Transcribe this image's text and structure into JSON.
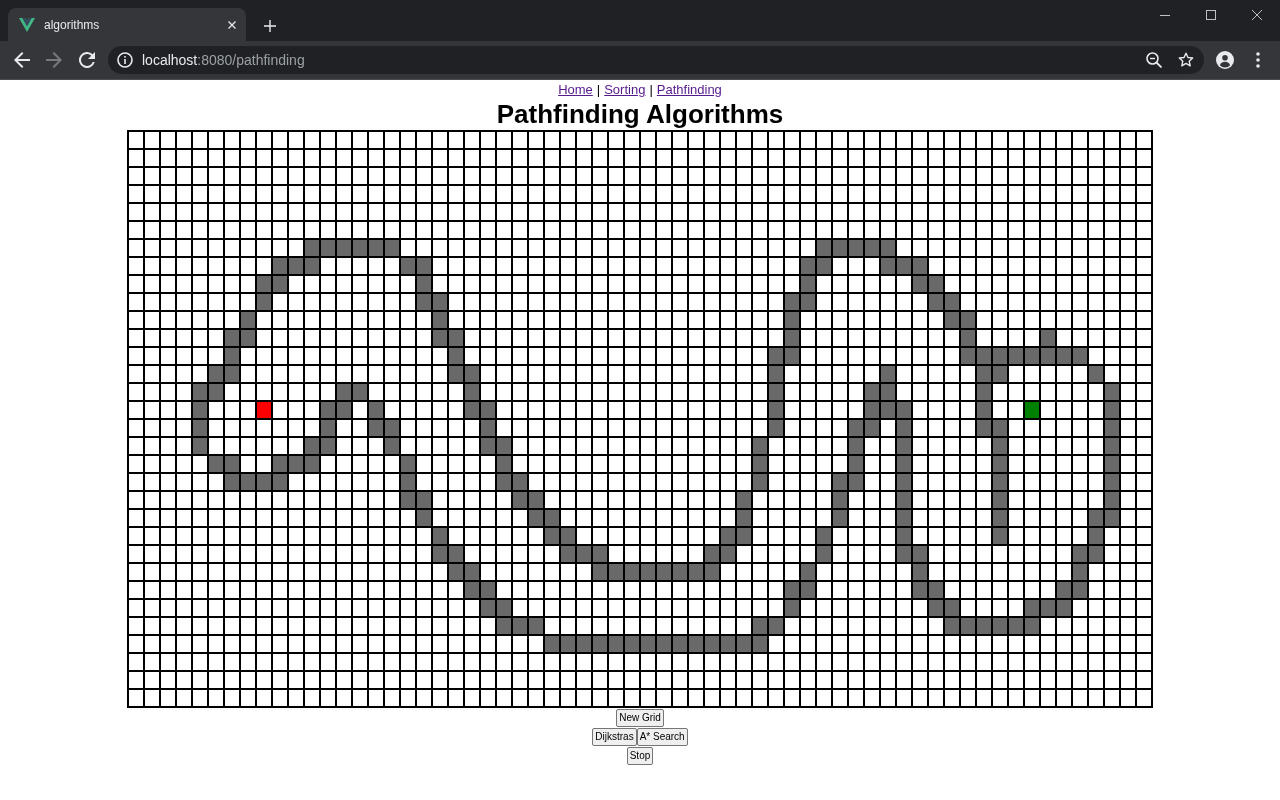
{
  "browser": {
    "tab_title": "algorithms",
    "back_button": {
      "disabled": false
    },
    "forward_button": {
      "disabled": true
    },
    "address": {
      "host": "localhost",
      "path": ":8080/pathfinding"
    }
  },
  "nav": [
    {
      "kind": "link",
      "text": "Home",
      "visited": true
    },
    {
      "kind": "divider",
      "text": "|"
    },
    {
      "kind": "link",
      "text": "Sorting",
      "visited": true
    },
    {
      "kind": "divider",
      "text": "|"
    },
    {
      "kind": "link",
      "text": "Pathfinding",
      "visited": true
    }
  ],
  "heading": "Pathfinding Algorithms",
  "grid": {
    "rows": [
      [
        false,
        false,
        false,
        false,
        false,
        false,
        false,
        false,
        false,
        false,
        false,
        false,
        false,
        false,
        false,
        false,
        false,
        false,
        false,
        false,
        false,
        false,
        false,
        false,
        false,
        false,
        false,
        false,
        false,
        false,
        false,
        false,
        false,
        false,
        false,
        false,
        false,
        false,
        false,
        false,
        false,
        false,
        false,
        false,
        false,
        false,
        false,
        false,
        false,
        false,
        false,
        false,
        false,
        false,
        false,
        false,
        false,
        false,
        false,
        false,
        false,
        false,
        false,
        false
      ],
      [
        false,
        false,
        false,
        false,
        false,
        false,
        false,
        false,
        false,
        false,
        false,
        false,
        false,
        false,
        false,
        false,
        false,
        false,
        false,
        false,
        false,
        false,
        false,
        false,
        false,
        false,
        false,
        false,
        false,
        false,
        false,
        false,
        false,
        false,
        false,
        false,
        false,
        false,
        false,
        false,
        false,
        false,
        false,
        false,
        false,
        false,
        false,
        false,
        false,
        false,
        false,
        false,
        false,
        false,
        false,
        false,
        false,
        false,
        false,
        false,
        false,
        false,
        false,
        false
      ],
      [
        false,
        false,
        false,
        false,
        false,
        false,
        false,
        false,
        false,
        false,
        false,
        false,
        false,
        false,
        false,
        false,
        false,
        false,
        false,
        false,
        false,
        false,
        false,
        false,
        false,
        false,
        false,
        false,
        false,
        false,
        false,
        false,
        false,
        false,
        false,
        false,
        false,
        false,
        false,
        false,
        false,
        false,
        false,
        false,
        false,
        false,
        false,
        false,
        false,
        false,
        false,
        false,
        false,
        false,
        false,
        false,
        false,
        false,
        false,
        false,
        false,
        false,
        false,
        false
      ],
      [
        false,
        false,
        false,
        false,
        false,
        false,
        false,
        false,
        false,
        false,
        false,
        false,
        false,
        false,
        false,
        false,
        false,
        false,
        false,
        false,
        false,
        false,
        false,
        false,
        false,
        false,
        false,
        false,
        false,
        false,
        false,
        false,
        false,
        false,
        false,
        false,
        false,
        false,
        false,
        false,
        false,
        false,
        false,
        false,
        false,
        false,
        false,
        false,
        false,
        false,
        false,
        false,
        false,
        false,
        false,
        false,
        false,
        false,
        false,
        false,
        false,
        false,
        false,
        false
      ],
      [
        false,
        false,
        false,
        false,
        false,
        false,
        false,
        false,
        false,
        false,
        false,
        false,
        false,
        false,
        false,
        false,
        false,
        false,
        false,
        false,
        false,
        false,
        false,
        false,
        false,
        false,
        false,
        false,
        false,
        false,
        false,
        false,
        false,
        false,
        false,
        false,
        false,
        false,
        false,
        false,
        false,
        false,
        false,
        false,
        false,
        false,
        false,
        false,
        false,
        false,
        false,
        false,
        false,
        false,
        false,
        false,
        false,
        false,
        false,
        false,
        false,
        false,
        false,
        false
      ],
      [
        false,
        false,
        false,
        false,
        false,
        false,
        false,
        false,
        false,
        false,
        false,
        false,
        false,
        false,
        false,
        false,
        false,
        false,
        false,
        false,
        false,
        false,
        false,
        false,
        false,
        false,
        false,
        false,
        false,
        false,
        false,
        false,
        false,
        false,
        false,
        false,
        false,
        false,
        false,
        false,
        false,
        false,
        false,
        false,
        false,
        false,
        false,
        false,
        false,
        false,
        false,
        false,
        false,
        false,
        false,
        false,
        false,
        false,
        false,
        false,
        false,
        false,
        false,
        false
      ],
      [
        false,
        false,
        false,
        false,
        false,
        false,
        false,
        false,
        false,
        false,
        false,
        true,
        true,
        true,
        true,
        true,
        true,
        false,
        false,
        false,
        false,
        false,
        false,
        false,
        false,
        false,
        false,
        false,
        false,
        false,
        false,
        false,
        false,
        false,
        false,
        false,
        false,
        false,
        false,
        false,
        false,
        false,
        false,
        true,
        true,
        true,
        true,
        true,
        false,
        false,
        false,
        false,
        false,
        false,
        false,
        false,
        false,
        false,
        false,
        false,
        false,
        false,
        false,
        false
      ],
      [
        false,
        false,
        false,
        false,
        false,
        false,
        false,
        false,
        false,
        true,
        true,
        true,
        false,
        false,
        false,
        false,
        false,
        true,
        true,
        false,
        false,
        false,
        false,
        false,
        false,
        false,
        false,
        false,
        false,
        false,
        false,
        false,
        false,
        false,
        false,
        false,
        false,
        false,
        false,
        false,
        false,
        false,
        true,
        true,
        false,
        false,
        false,
        true,
        true,
        true,
        false,
        false,
        false,
        false,
        false,
        false,
        false,
        false,
        false,
        false,
        false,
        false,
        false,
        false
      ],
      [
        false,
        false,
        false,
        false,
        false,
        false,
        false,
        false,
        true,
        true,
        false,
        false,
        false,
        false,
        false,
        false,
        false,
        false,
        true,
        false,
        false,
        false,
        false,
        false,
        false,
        false,
        false,
        false,
        false,
        false,
        false,
        false,
        false,
        false,
        false,
        false,
        false,
        false,
        false,
        false,
        false,
        false,
        true,
        false,
        false,
        false,
        false,
        false,
        false,
        true,
        true,
        false,
        false,
        false,
        false,
        false,
        false,
        false,
        false,
        false,
        false,
        false,
        false,
        false
      ],
      [
        false,
        false,
        false,
        false,
        false,
        false,
        false,
        false,
        true,
        false,
        false,
        false,
        false,
        false,
        false,
        false,
        false,
        false,
        true,
        true,
        false,
        false,
        false,
        false,
        false,
        false,
        false,
        false,
        false,
        false,
        false,
        false,
        false,
        false,
        false,
        false,
        false,
        false,
        false,
        false,
        false,
        true,
        true,
        false,
        false,
        false,
        false,
        false,
        false,
        false,
        true,
        true,
        false,
        false,
        false,
        false,
        false,
        false,
        false,
        false,
        false,
        false,
        false,
        false
      ],
      [
        false,
        false,
        false,
        false,
        false,
        false,
        false,
        true,
        false,
        false,
        false,
        false,
        false,
        false,
        false,
        false,
        false,
        false,
        false,
        true,
        false,
        false,
        false,
        false,
        false,
        false,
        false,
        false,
        false,
        false,
        false,
        false,
        false,
        false,
        false,
        false,
        false,
        false,
        false,
        false,
        false,
        true,
        false,
        false,
        false,
        false,
        false,
        false,
        false,
        false,
        false,
        true,
        true,
        false,
        false,
        false,
        false,
        false,
        false,
        false,
        false,
        false,
        false,
        false
      ],
      [
        false,
        false,
        false,
        false,
        false,
        false,
        true,
        true,
        false,
        false,
        false,
        false,
        false,
        false,
        false,
        false,
        false,
        false,
        false,
        true,
        true,
        false,
        false,
        false,
        false,
        false,
        false,
        false,
        false,
        false,
        false,
        false,
        false,
        false,
        false,
        false,
        false,
        false,
        false,
        false,
        false,
        true,
        false,
        false,
        false,
        false,
        false,
        false,
        false,
        false,
        false,
        false,
        true,
        false,
        false,
        false,
        false,
        true,
        false,
        false,
        false,
        false,
        false,
        false
      ],
      [
        false,
        false,
        false,
        false,
        false,
        false,
        true,
        false,
        false,
        false,
        false,
        false,
        false,
        false,
        false,
        false,
        false,
        false,
        false,
        false,
        true,
        false,
        false,
        false,
        false,
        false,
        false,
        false,
        false,
        false,
        false,
        false,
        false,
        false,
        false,
        false,
        false,
        false,
        false,
        false,
        true,
        true,
        false,
        false,
        false,
        false,
        false,
        false,
        false,
        false,
        false,
        false,
        true,
        true,
        true,
        true,
        true,
        true,
        true,
        true,
        false,
        false,
        false,
        false
      ],
      [
        false,
        false,
        false,
        false,
        false,
        true,
        true,
        false,
        false,
        false,
        false,
        false,
        false,
        false,
        false,
        false,
        false,
        false,
        false,
        false,
        true,
        true,
        false,
        false,
        false,
        false,
        false,
        false,
        false,
        false,
        false,
        false,
        false,
        false,
        false,
        false,
        false,
        false,
        false,
        false,
        true,
        false,
        false,
        false,
        false,
        false,
        false,
        true,
        false,
        false,
        false,
        false,
        false,
        true,
        true,
        false,
        false,
        false,
        false,
        false,
        true,
        false,
        false,
        false
      ],
      [
        false,
        false,
        false,
        false,
        true,
        true,
        false,
        false,
        false,
        false,
        false,
        false,
        false,
        true,
        true,
        false,
        false,
        false,
        false,
        false,
        false,
        true,
        false,
        false,
        false,
        false,
        false,
        false,
        false,
        false,
        false,
        false,
        false,
        false,
        false,
        false,
        false,
        false,
        false,
        false,
        true,
        false,
        false,
        false,
        false,
        false,
        true,
        true,
        false,
        false,
        false,
        false,
        false,
        true,
        false,
        false,
        false,
        false,
        false,
        false,
        false,
        true,
        false,
        false
      ],
      [
        false,
        false,
        false,
        false,
        true,
        false,
        false,
        false,
        {
          "kind": "start"
        },
        false,
        false,
        false,
        true,
        true,
        false,
        true,
        false,
        false,
        false,
        false,
        false,
        true,
        true,
        false,
        false,
        false,
        false,
        false,
        false,
        false,
        false,
        false,
        false,
        false,
        false,
        false,
        false,
        false,
        false,
        false,
        true,
        false,
        false,
        false,
        false,
        false,
        true,
        true,
        true,
        false,
        false,
        false,
        false,
        true,
        false,
        false,
        {
          "kind": "end"
        },
        false,
        false,
        false,
        false,
        true,
        false,
        false
      ],
      [
        false,
        false,
        false,
        false,
        true,
        false,
        false,
        false,
        false,
        false,
        false,
        false,
        true,
        false,
        false,
        true,
        true,
        false,
        false,
        false,
        false,
        false,
        true,
        false,
        false,
        false,
        false,
        false,
        false,
        false,
        false,
        false,
        false,
        false,
        false,
        false,
        false,
        false,
        false,
        false,
        true,
        false,
        false,
        false,
        false,
        true,
        true,
        false,
        true,
        false,
        false,
        false,
        false,
        true,
        true,
        false,
        false,
        false,
        false,
        false,
        false,
        true,
        false,
        false
      ],
      [
        false,
        false,
        false,
        false,
        true,
        false,
        false,
        false,
        false,
        false,
        false,
        true,
        true,
        false,
        false,
        false,
        true,
        false,
        false,
        false,
        false,
        false,
        true,
        true,
        false,
        false,
        false,
        false,
        false,
        false,
        false,
        false,
        false,
        false,
        false,
        false,
        false,
        false,
        false,
        true,
        false,
        false,
        false,
        false,
        false,
        true,
        false,
        false,
        true,
        false,
        false,
        false,
        false,
        false,
        true,
        false,
        false,
        false,
        false,
        false,
        false,
        true,
        false,
        false
      ],
      [
        false,
        false,
        false,
        false,
        false,
        true,
        true,
        false,
        false,
        true,
        true,
        true,
        false,
        false,
        false,
        false,
        false,
        true,
        false,
        false,
        false,
        false,
        false,
        true,
        false,
        false,
        false,
        false,
        false,
        false,
        false,
        false,
        false,
        false,
        false,
        false,
        false,
        false,
        false,
        true,
        false,
        false,
        false,
        false,
        false,
        true,
        false,
        false,
        true,
        false,
        false,
        false,
        false,
        false,
        true,
        false,
        false,
        false,
        false,
        false,
        false,
        true,
        false,
        false
      ],
      [
        false,
        false,
        false,
        false,
        false,
        false,
        true,
        true,
        true,
        true,
        false,
        false,
        false,
        false,
        false,
        false,
        false,
        true,
        false,
        false,
        false,
        false,
        false,
        true,
        true,
        false,
        false,
        false,
        false,
        false,
        false,
        false,
        false,
        false,
        false,
        false,
        false,
        false,
        false,
        true,
        false,
        false,
        false,
        false,
        true,
        true,
        false,
        false,
        true,
        false,
        false,
        false,
        false,
        false,
        true,
        false,
        false,
        false,
        false,
        false,
        false,
        true,
        false,
        false
      ],
      [
        false,
        false,
        false,
        false,
        false,
        false,
        false,
        false,
        false,
        false,
        false,
        false,
        false,
        false,
        false,
        false,
        false,
        true,
        true,
        false,
        false,
        false,
        false,
        false,
        true,
        true,
        false,
        false,
        false,
        false,
        false,
        false,
        false,
        false,
        false,
        false,
        false,
        false,
        true,
        false,
        false,
        false,
        false,
        false,
        true,
        false,
        false,
        false,
        true,
        false,
        false,
        false,
        false,
        false,
        true,
        false,
        false,
        false,
        false,
        false,
        false,
        true,
        false,
        false
      ],
      [
        false,
        false,
        false,
        false,
        false,
        false,
        false,
        false,
        false,
        false,
        false,
        false,
        false,
        false,
        false,
        false,
        false,
        false,
        true,
        false,
        false,
        false,
        false,
        false,
        false,
        true,
        true,
        false,
        false,
        false,
        false,
        false,
        false,
        false,
        false,
        false,
        false,
        false,
        true,
        false,
        false,
        false,
        false,
        false,
        true,
        false,
        false,
        false,
        true,
        false,
        false,
        false,
        false,
        false,
        true,
        false,
        false,
        false,
        false,
        false,
        true,
        true,
        false,
        false
      ],
      [
        false,
        false,
        false,
        false,
        false,
        false,
        false,
        false,
        false,
        false,
        false,
        false,
        false,
        false,
        false,
        false,
        false,
        false,
        false,
        true,
        false,
        false,
        false,
        false,
        false,
        false,
        true,
        true,
        false,
        false,
        false,
        false,
        false,
        false,
        false,
        false,
        false,
        true,
        true,
        false,
        false,
        false,
        false,
        true,
        false,
        false,
        false,
        false,
        true,
        false,
        false,
        false,
        false,
        false,
        true,
        false,
        false,
        false,
        false,
        false,
        true,
        false,
        false,
        false
      ],
      [
        false,
        false,
        false,
        false,
        false,
        false,
        false,
        false,
        false,
        false,
        false,
        false,
        false,
        false,
        false,
        false,
        false,
        false,
        false,
        true,
        true,
        false,
        false,
        false,
        false,
        false,
        false,
        true,
        true,
        true,
        false,
        false,
        false,
        false,
        false,
        false,
        true,
        true,
        false,
        false,
        false,
        false,
        false,
        true,
        false,
        false,
        false,
        false,
        true,
        true,
        false,
        false,
        false,
        false,
        false,
        false,
        false,
        false,
        false,
        true,
        true,
        false,
        false,
        false
      ],
      [
        false,
        false,
        false,
        false,
        false,
        false,
        false,
        false,
        false,
        false,
        false,
        false,
        false,
        false,
        false,
        false,
        false,
        false,
        false,
        false,
        true,
        true,
        false,
        false,
        false,
        false,
        false,
        false,
        false,
        true,
        true,
        true,
        true,
        true,
        true,
        true,
        true,
        false,
        false,
        false,
        false,
        false,
        true,
        false,
        false,
        false,
        false,
        false,
        false,
        true,
        false,
        false,
        false,
        false,
        false,
        false,
        false,
        false,
        false,
        true,
        false,
        false,
        false,
        false
      ],
      [
        false,
        false,
        false,
        false,
        false,
        false,
        false,
        false,
        false,
        false,
        false,
        false,
        false,
        false,
        false,
        false,
        false,
        false,
        false,
        false,
        false,
        true,
        true,
        false,
        false,
        false,
        false,
        false,
        false,
        false,
        false,
        false,
        false,
        false,
        false,
        false,
        false,
        false,
        false,
        false,
        false,
        true,
        true,
        false,
        false,
        false,
        false,
        false,
        false,
        true,
        true,
        false,
        false,
        false,
        false,
        false,
        false,
        false,
        true,
        true,
        false,
        false,
        false,
        false
      ],
      [
        false,
        false,
        false,
        false,
        false,
        false,
        false,
        false,
        false,
        false,
        false,
        false,
        false,
        false,
        false,
        false,
        false,
        false,
        false,
        false,
        false,
        false,
        true,
        true,
        false,
        false,
        false,
        false,
        false,
        false,
        false,
        false,
        false,
        false,
        false,
        false,
        false,
        false,
        false,
        false,
        false,
        true,
        false,
        false,
        false,
        false,
        false,
        false,
        false,
        false,
        true,
        true,
        false,
        false,
        false,
        false,
        true,
        true,
        true,
        false,
        false,
        false,
        false,
        false
      ],
      [
        false,
        false,
        false,
        false,
        false,
        false,
        false,
        false,
        false,
        false,
        false,
        false,
        false,
        false,
        false,
        false,
        false,
        false,
        false,
        false,
        false,
        false,
        false,
        true,
        true,
        true,
        false,
        false,
        false,
        false,
        false,
        false,
        false,
        false,
        false,
        false,
        false,
        false,
        false,
        true,
        true,
        false,
        false,
        false,
        false,
        false,
        false,
        false,
        false,
        false,
        false,
        true,
        true,
        true,
        true,
        true,
        true,
        false,
        false,
        false,
        false,
        false,
        false,
        false
      ],
      [
        false,
        false,
        false,
        false,
        false,
        false,
        false,
        false,
        false,
        false,
        false,
        false,
        false,
        false,
        false,
        false,
        false,
        false,
        false,
        false,
        false,
        false,
        false,
        false,
        false,
        false,
        true,
        true,
        true,
        true,
        true,
        true,
        true,
        true,
        true,
        true,
        true,
        true,
        true,
        true,
        false,
        false,
        false,
        false,
        false,
        false,
        false,
        false,
        false,
        false,
        false,
        false,
        false,
        false,
        false,
        false,
        false,
        false,
        false,
        false,
        false,
        false,
        false,
        false
      ],
      [
        false,
        false,
        false,
        false,
        false,
        false,
        false,
        false,
        false,
        false,
        false,
        false,
        false,
        false,
        false,
        false,
        false,
        false,
        false,
        false,
        false,
        false,
        false,
        false,
        false,
        false,
        false,
        false,
        false,
        false,
        false,
        false,
        false,
        false,
        false,
        false,
        false,
        false,
        false,
        false,
        false,
        false,
        false,
        false,
        false,
        false,
        false,
        false,
        false,
        false,
        false,
        false,
        false,
        false,
        false,
        false,
        false,
        false,
        false,
        false,
        false,
        false,
        false,
        false
      ],
      [
        false,
        false,
        false,
        false,
        false,
        false,
        false,
        false,
        false,
        false,
        false,
        false,
        false,
        false,
        false,
        false,
        false,
        false,
        false,
        false,
        false,
        false,
        false,
        false,
        false,
        false,
        false,
        false,
        false,
        false,
        false,
        false,
        false,
        false,
        false,
        false,
        false,
        false,
        false,
        false,
        false,
        false,
        false,
        false,
        false,
        false,
        false,
        false,
        false,
        false,
        false,
        false,
        false,
        false,
        false,
        false,
        false,
        false,
        false,
        false,
        false,
        false,
        false,
        false
      ],
      [
        false,
        false,
        false,
        false,
        false,
        false,
        false,
        false,
        false,
        false,
        false,
        false,
        false,
        false,
        false,
        false,
        false,
        false,
        false,
        false,
        false,
        false,
        false,
        false,
        false,
        false,
        false,
        false,
        false,
        false,
        false,
        false,
        false,
        false,
        false,
        false,
        false,
        false,
        false,
        false,
        false,
        false,
        false,
        false,
        false,
        false,
        false,
        false,
        false,
        false,
        false,
        false,
        false,
        false,
        false,
        false,
        false,
        false,
        false,
        false,
        false,
        false,
        false,
        false
      ]
    ]
  },
  "button_rows": [
    [
      "New Grid"
    ],
    [
      "Dijkstras",
      "A* Search"
    ],
    [
      "Stop"
    ]
  ]
}
